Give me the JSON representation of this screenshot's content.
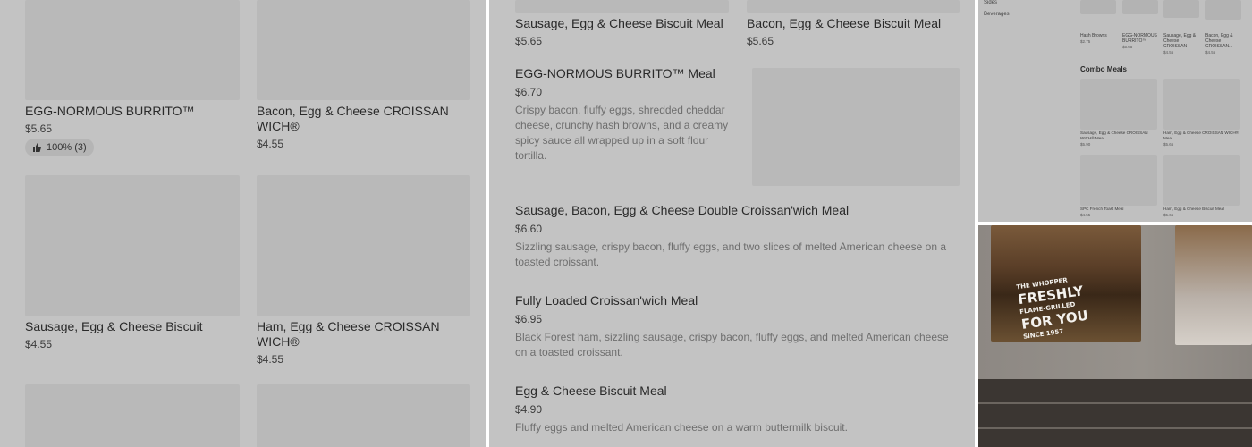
{
  "panel_a": {
    "items": [
      {
        "title": "EGG-NORMOUS BURRITO™",
        "price": "$5.65",
        "rating": "100% (3)"
      },
      {
        "title": "Bacon, Egg & Cheese CROISSAN WICH®",
        "price": "$4.55"
      },
      {
        "title": "Sausage, Egg & Cheese Biscuit",
        "price": "$4.55"
      },
      {
        "title": "Ham, Egg & Cheese CROISSAN WICH®",
        "price": "$4.55"
      }
    ]
  },
  "panel_b": {
    "top_items": [
      {
        "title": "Sausage, Egg & Cheese Biscuit Meal",
        "price": "$5.65"
      },
      {
        "title": "Bacon, Egg & Cheese Biscuit Meal",
        "price": "$5.65"
      }
    ],
    "list": [
      {
        "title": "EGG-NORMOUS BURRITO™ Meal",
        "price": "$6.70",
        "desc": "Crispy bacon, fluffy eggs, shredded cheddar cheese, crunchy hash browns, and a creamy spicy sauce all wrapped up in a soft flour tortilla."
      },
      {
        "title": "Sausage, Bacon, Egg & Cheese Double Croissan'wich Meal",
        "price": "$6.60",
        "desc": "Sizzling sausage, crispy bacon, fluffy eggs, and two slices of melted American cheese on a toasted croissant."
      },
      {
        "title": "Fully Loaded Croissan'wich Meal",
        "price": "$6.95",
        "desc": "Black Forest ham, sizzling sausage, crispy bacon, fluffy eggs, and melted American cheese on a toasted croissant."
      },
      {
        "title": "Egg & Cheese Biscuit Meal",
        "price": "$4.90",
        "desc": "Fluffy eggs and melted American cheese on a warm buttermilk biscuit."
      }
    ]
  },
  "panel_c": {
    "nav": [
      "Sides",
      "Beverages"
    ],
    "small_items": [
      {
        "title": "Hash Browns",
        "price": "$2.75"
      },
      {
        "title": "EGG-NORMOUS BURRITO™",
        "price": "$5.65"
      },
      {
        "title": "Sausage, Egg & Cheese CROISSAN",
        "price": "$4.55"
      },
      {
        "title": "Bacon, Egg & Cheese CROISSAN...",
        "price": "$4.55"
      }
    ],
    "section_title": "Combo Meals",
    "combo_items": [
      {
        "title": "Sausage, Egg & Cheese CROISSAN WICH® Meal",
        "price": "$5.90"
      },
      {
        "title": "Ham, Egg & Cheese CROISSAN WICH® Meal",
        "price": "$5.65"
      },
      {
        "title": "SPC French Toast Meal",
        "price": "$4.55"
      },
      {
        "title": "Ham, Egg & Cheese Biscuit Meal",
        "price": "$5.65"
      }
    ]
  },
  "panel_d": {
    "poster_lines": [
      "THE WHOPPER",
      "FRESHLY",
      "FLAME-GRILLED",
      "FOR YOU",
      "SINCE 1957"
    ]
  },
  "colors": {
    "panel_bg": "#c3c3c3",
    "placeholder": "#b9b9b9"
  }
}
